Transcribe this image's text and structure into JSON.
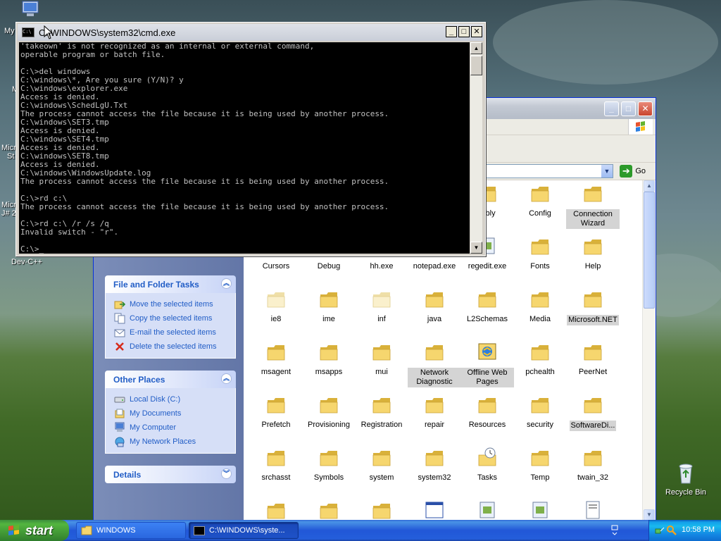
{
  "desktop": {
    "icons": [
      {
        "label": "Dev-C++"
      },
      {
        "label": "Recycle Bin"
      }
    ],
    "partial_labels": [
      "My",
      "M",
      "Micr",
      "St",
      "Micr",
      "J# 2"
    ]
  },
  "cmd": {
    "title": "C:\\WINDOWS\\system32\\cmd.exe",
    "lines": [
      "'takeown' is not recognized as an internal or external command,",
      "operable program or batch file.",
      "",
      "C:\\>del windows",
      "C:\\windows\\*, Are you sure (Y/N)? y",
      "C:\\windows\\explorer.exe",
      "Access is denied.",
      "C:\\windows\\SchedLgU.Txt",
      "The process cannot access the file because it is being used by another process.",
      "C:\\windows\\SET3.tmp",
      "Access is denied.",
      "C:\\windows\\SET4.tmp",
      "Access is denied.",
      "C:\\windows\\SET8.tmp",
      "Access is denied.",
      "C:\\windows\\WindowsUpdate.log",
      "The process cannot access the file because it is being used by another process.",
      "",
      "C:\\>rd c:\\",
      "The process cannot access the file because it is being used by another process.",
      "",
      "C:\\>rd c:\\ /r /s /q",
      "Invalid switch - \"r\".",
      "",
      "C:\\>_"
    ]
  },
  "explorer": {
    "address_go": "Go",
    "file_tasks": {
      "title": "File and Folder Tasks",
      "items": [
        {
          "label": "Move the selected items",
          "icon": "move-icon"
        },
        {
          "label": "Copy the selected items",
          "icon": "copy-icon"
        },
        {
          "label": "E-mail the selected items",
          "icon": "email-icon"
        },
        {
          "label": "Delete the selected items",
          "icon": "delete-icon"
        }
      ]
    },
    "other_places": {
      "title": "Other Places",
      "items": [
        {
          "label": "Local Disk (C:)",
          "icon": "drive-icon"
        },
        {
          "label": "My Documents",
          "icon": "documents-icon"
        },
        {
          "label": "My Computer",
          "icon": "computer-icon"
        },
        {
          "label": "My Network Places",
          "icon": "network-icon"
        }
      ]
    },
    "details": {
      "title": "Details"
    },
    "files": [
      {
        "label": "...bly",
        "type": "folder"
      },
      {
        "label": "Config",
        "type": "folder"
      },
      {
        "label": "Connection Wizard",
        "type": "folder",
        "selected": true
      },
      {
        "label": "Cursors",
        "type": "folder"
      },
      {
        "label": "Debug",
        "type": "folder"
      },
      {
        "label": "hh.exe",
        "type": "exe"
      },
      {
        "label": "notepad.exe",
        "type": "exe"
      },
      {
        "label": "regedit.exe",
        "type": "exe"
      },
      {
        "label": "Fonts",
        "type": "folder"
      },
      {
        "label": "Help",
        "type": "folder"
      },
      {
        "label": "ie8",
        "type": "folder-faded"
      },
      {
        "label": "ime",
        "type": "folder"
      },
      {
        "label": "inf",
        "type": "folder-faded"
      },
      {
        "label": "java",
        "type": "folder"
      },
      {
        "label": "L2Schemas",
        "type": "folder"
      },
      {
        "label": "Media",
        "type": "folder"
      },
      {
        "label": "Microsoft.NET",
        "type": "folder",
        "selected": true
      },
      {
        "label": "msagent",
        "type": "folder"
      },
      {
        "label": "msapps",
        "type": "folder"
      },
      {
        "label": "mui",
        "type": "folder"
      },
      {
        "label": "Network Diagnostic",
        "type": "folder",
        "selected": true
      },
      {
        "label": "Offline Web Pages",
        "type": "special",
        "selected": true
      },
      {
        "label": "pchealth",
        "type": "folder"
      },
      {
        "label": "PeerNet",
        "type": "folder"
      },
      {
        "label": "Prefetch",
        "type": "folder"
      },
      {
        "label": "Provisioning",
        "type": "folder"
      },
      {
        "label": "Registration",
        "type": "folder"
      },
      {
        "label": "repair",
        "type": "folder"
      },
      {
        "label": "Resources",
        "type": "folder"
      },
      {
        "label": "security",
        "type": "folder"
      },
      {
        "label": "SoftwareDi...",
        "type": "folder",
        "selected": true
      },
      {
        "label": "srchasst",
        "type": "folder"
      },
      {
        "label": "Symbols",
        "type": "folder"
      },
      {
        "label": "system",
        "type": "folder"
      },
      {
        "label": "system32",
        "type": "folder"
      },
      {
        "label": "Tasks",
        "type": "tasks"
      },
      {
        "label": "Temp",
        "type": "folder"
      },
      {
        "label": "twain_32",
        "type": "folder"
      },
      {
        "label": "",
        "type": "folder"
      },
      {
        "label": "",
        "type": "folder"
      },
      {
        "label": "",
        "type": "folder"
      },
      {
        "label": "",
        "type": "window"
      },
      {
        "label": "",
        "type": "exe"
      },
      {
        "label": "",
        "type": "exe"
      },
      {
        "label": "",
        "type": "doc"
      }
    ]
  },
  "taskbar": {
    "start_label": "start",
    "tasks": [
      {
        "label": "WINDOWS",
        "active": false
      },
      {
        "label": "C:\\WINDOWS\\syste...",
        "active": true
      }
    ],
    "clock": "10:58 PM"
  },
  "colors": {
    "folder": "#f6d66e",
    "folder_dark": "#d9b13a",
    "panel_link": "#215dc6",
    "taskbar": "#245edb",
    "start_green": "#3a8c31"
  }
}
